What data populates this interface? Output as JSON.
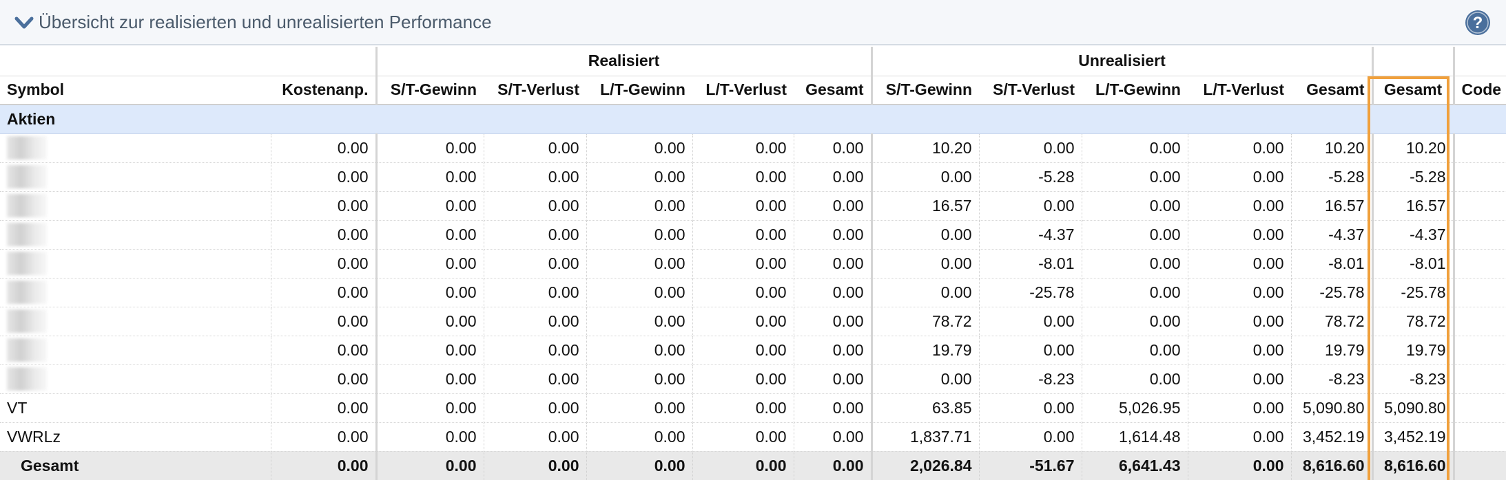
{
  "panel": {
    "title": "Übersicht zur realisierten und unrealisierten Performance",
    "toggle_icon": "chevron-down-icon",
    "help_icon": "help-icon",
    "colors": {
      "header_bg": "#f5f7fa",
      "title": "#4a5a6b",
      "category_bg": "#dde9fb",
      "total_bg": "#e9e9e9",
      "highlight": "#f0a03c",
      "help": "#4a6f9c"
    }
  },
  "table": {
    "groups": {
      "realized": "Realisiert",
      "unrealized": "Unrealisiert"
    },
    "columns": [
      "Symbol",
      "Kostenanp.",
      "S/T-Gewinn",
      "S/T-Verlust",
      "L/T-Gewinn",
      "L/T-Verlust",
      "Gesamt",
      "S/T-Gewinn",
      "S/T-Verlust",
      "L/T-Gewinn",
      "L/T-Verlust",
      "Gesamt",
      "Gesamt",
      "Code"
    ],
    "category": "Aktien",
    "rows": [
      {
        "symbol": "",
        "values": [
          "0.00",
          "0.00",
          "0.00",
          "0.00",
          "0.00",
          "0.00",
          "10.20",
          "0.00",
          "0.00",
          "0.00",
          "10.20",
          "10.20",
          ""
        ]
      },
      {
        "symbol": "",
        "values": [
          "0.00",
          "0.00",
          "0.00",
          "0.00",
          "0.00",
          "0.00",
          "0.00",
          "-5.28",
          "0.00",
          "0.00",
          "-5.28",
          "-5.28",
          ""
        ]
      },
      {
        "symbol": "",
        "values": [
          "0.00",
          "0.00",
          "0.00",
          "0.00",
          "0.00",
          "0.00",
          "16.57",
          "0.00",
          "0.00",
          "0.00",
          "16.57",
          "16.57",
          ""
        ]
      },
      {
        "symbol": "",
        "values": [
          "0.00",
          "0.00",
          "0.00",
          "0.00",
          "0.00",
          "0.00",
          "0.00",
          "-4.37",
          "0.00",
          "0.00",
          "-4.37",
          "-4.37",
          ""
        ]
      },
      {
        "symbol": "",
        "values": [
          "0.00",
          "0.00",
          "0.00",
          "0.00",
          "0.00",
          "0.00",
          "0.00",
          "-8.01",
          "0.00",
          "0.00",
          "-8.01",
          "-8.01",
          ""
        ]
      },
      {
        "symbol": "",
        "values": [
          "0.00",
          "0.00",
          "0.00",
          "0.00",
          "0.00",
          "0.00",
          "0.00",
          "-25.78",
          "0.00",
          "0.00",
          "-25.78",
          "-25.78",
          ""
        ]
      },
      {
        "symbol": "",
        "values": [
          "0.00",
          "0.00",
          "0.00",
          "0.00",
          "0.00",
          "0.00",
          "78.72",
          "0.00",
          "0.00",
          "0.00",
          "78.72",
          "78.72",
          ""
        ]
      },
      {
        "symbol": "",
        "values": [
          "0.00",
          "0.00",
          "0.00",
          "0.00",
          "0.00",
          "0.00",
          "19.79",
          "0.00",
          "0.00",
          "0.00",
          "19.79",
          "19.79",
          ""
        ]
      },
      {
        "symbol": "",
        "values": [
          "0.00",
          "0.00",
          "0.00",
          "0.00",
          "0.00",
          "0.00",
          "0.00",
          "-8.23",
          "0.00",
          "0.00",
          "-8.23",
          "-8.23",
          ""
        ]
      },
      {
        "symbol": "VT",
        "values": [
          "0.00",
          "0.00",
          "0.00",
          "0.00",
          "0.00",
          "0.00",
          "63.85",
          "0.00",
          "5,026.95",
          "0.00",
          "5,090.80",
          "5,090.80",
          ""
        ]
      },
      {
        "symbol": "VWRLz",
        "values": [
          "0.00",
          "0.00",
          "0.00",
          "0.00",
          "0.00",
          "0.00",
          "1,837.71",
          "0.00",
          "1,614.48",
          "0.00",
          "3,452.19",
          "3,452.19",
          ""
        ]
      }
    ],
    "total": {
      "symbol": "Gesamt",
      "values": [
        "0.00",
        "0.00",
        "0.00",
        "0.00",
        "0.00",
        "0.00",
        "2,026.84",
        "-51.67",
        "6,641.43",
        "0.00",
        "8,616.60",
        "8,616.60",
        ""
      ]
    }
  }
}
